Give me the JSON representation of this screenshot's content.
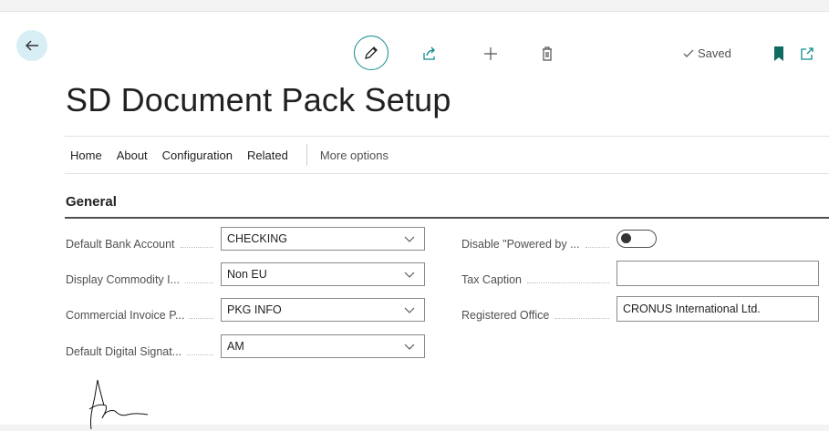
{
  "toolbar": {
    "saved_label": "Saved",
    "icons": [
      "back-arrow-icon",
      "edit-pencil-icon",
      "share-icon",
      "plus-icon",
      "trash-icon",
      "checkmark-icon",
      "bookmark-icon",
      "open-new-window-icon"
    ],
    "accent_color": "#0f8b8d",
    "bookmark_color": "#0f6b62"
  },
  "page": {
    "title": "SD Document Pack Setup"
  },
  "menu": {
    "items": [
      "Home",
      "About",
      "Configuration",
      "Related"
    ],
    "more": "More options"
  },
  "general": {
    "title": "General",
    "left_fields": [
      {
        "label": "Default Bank Account",
        "value": "CHECKING"
      },
      {
        "label": "Display Commodity I...",
        "value": "Non EU"
      },
      {
        "label": "Commercial Invoice P...",
        "value": "PKG INFO"
      },
      {
        "label": "Default Digital Signat...",
        "value": "AM"
      }
    ],
    "right_fields": [
      {
        "label": "Disable \"Powered by ...",
        "value": "off"
      },
      {
        "label": "Tax Caption",
        "value": ""
      },
      {
        "label": "Registered Office",
        "value": "CRONUS International Ltd."
      }
    ]
  }
}
